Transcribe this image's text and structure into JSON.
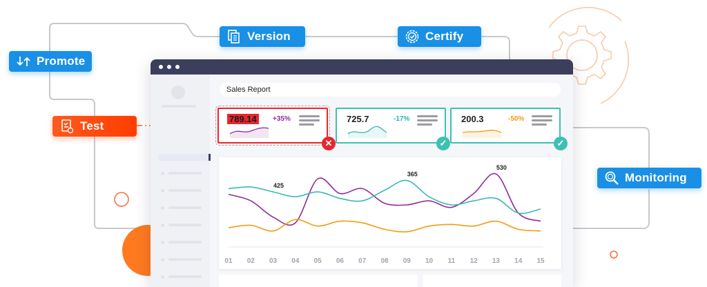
{
  "flow": {
    "promote": {
      "label": "Promote"
    },
    "version": {
      "label": "Version"
    },
    "certify": {
      "label": "Certify"
    },
    "test": {
      "label": "Test"
    },
    "monitoring": {
      "label": "Monitoring"
    }
  },
  "report": {
    "title": "Sales Report",
    "cards": [
      {
        "value": "789.14",
        "change": "+35%",
        "status": "failed",
        "change_color": "#8e2a9c"
      },
      {
        "value": "725.7",
        "change": "-17%",
        "status": "passed",
        "change_color": "#26b3a8"
      },
      {
        "value": "200.3",
        "change": "-50%",
        "status": "passed",
        "change_color": "#f39a0d"
      }
    ]
  },
  "colors": {
    "accent_blue": "#1a8fe6",
    "test_orange": "#ff4d12",
    "fail_red": "#e8262e",
    "pass_teal": "#3cc1b2",
    "purple": "#8e2a9c",
    "teal": "#39b8b4",
    "orange": "#f39a0d"
  },
  "chart_data": {
    "type": "line",
    "x": [
      "01",
      "02",
      "03",
      "04",
      "05",
      "06",
      "07",
      "08",
      "09",
      "10",
      "11",
      "12",
      "13",
      "14",
      "15"
    ],
    "series": [
      {
        "values": [
          63,
          55,
          35,
          28,
          82,
          64,
          70,
          52,
          50,
          55,
          47,
          64,
          88,
          40,
          30
        ],
        "color": "#8e2a9c"
      },
      {
        "values": [
          70,
          72,
          66,
          60,
          66,
          58,
          55,
          68,
          80,
          60,
          50,
          55,
          58,
          40,
          45
        ],
        "color": "#39b8b4"
      },
      {
        "values": [
          22,
          25,
          18,
          32,
          24,
          30,
          28,
          20,
          17,
          24,
          26,
          24,
          30,
          20,
          18
        ],
        "color": "#f39a0d"
      }
    ],
    "annotations": [
      {
        "x": "03",
        "label": "425"
      },
      {
        "x": "09",
        "label": "365"
      },
      {
        "x": "13",
        "label": "530"
      }
    ],
    "ylim": [
      0,
      100
    ],
    "grid": false
  }
}
